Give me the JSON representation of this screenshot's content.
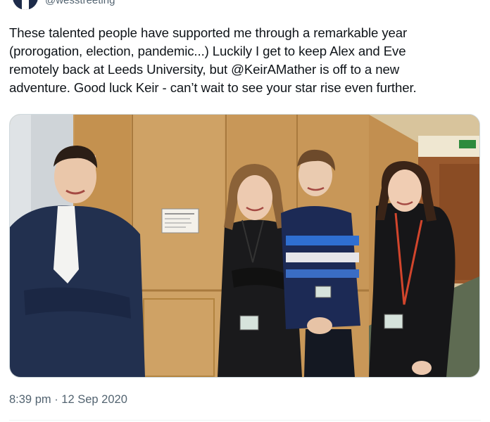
{
  "author": {
    "handle": "@wesstreeting",
    "avatar_icon": "profile-photo"
  },
  "tweet": {
    "lines": [
      "These talented people have supported me through a remarkable year",
      "(prorogation, election, pandemic...) Luckily I get to keep Alex and Eve",
      "remotely back at Leeds University, but @KeirAMather is off to a new",
      "adventure. Good luck Keir - can’t wait to see your star rise even further."
    ],
    "timestamp": "8:39 pm · 12 Sep 2020"
  },
  "colors": {
    "text": "#0f1419",
    "muted": "#536471",
    "border": "#cfd9de"
  }
}
